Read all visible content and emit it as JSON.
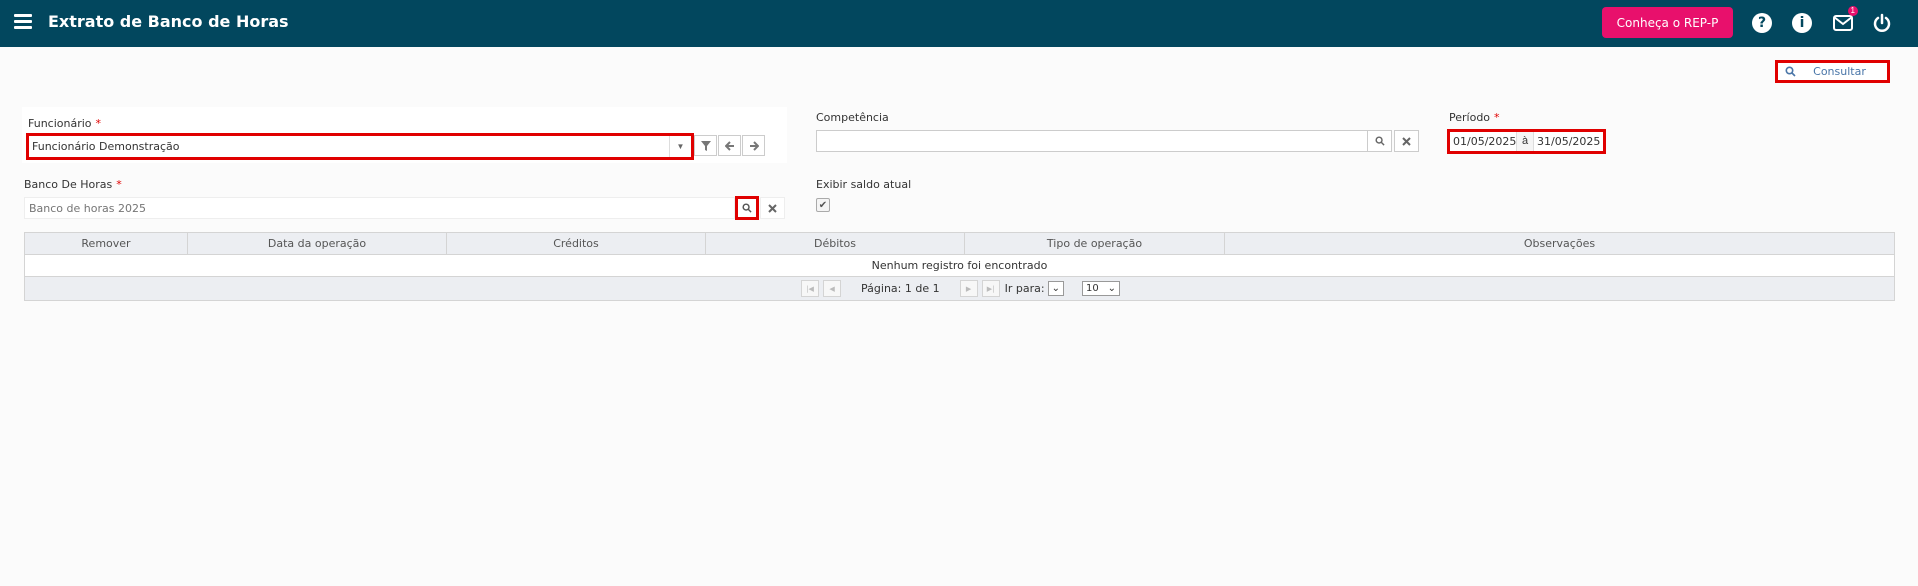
{
  "header": {
    "title": "Extrato de Banco de Horas",
    "rep_button": "Conheça o REP-P",
    "help_icon": "?",
    "info_icon": "i",
    "mail_badge": "1"
  },
  "toolbar": {
    "consultar_label": "Consultar"
  },
  "form": {
    "funcionario_label": "Funcionário",
    "funcionario_value": "Funcionário Demonstração",
    "competencia_label": "Competência",
    "competencia_value": "",
    "periodo_label": "Período",
    "periodo_start": "01/05/2025",
    "periodo_sep": "à",
    "periodo_end": "31/05/2025",
    "banco_label": "Banco De Horas",
    "banco_placeholder": "Banco de horas 2025",
    "exibir_label": "Exibir saldo atual",
    "required_mark": "*"
  },
  "grid": {
    "columns": [
      "Remover",
      "Data da operação",
      "Créditos",
      "Débitos",
      "Tipo de operação",
      "Observações"
    ],
    "empty_message": "Nenhum registro foi encontrado",
    "pager_text": "Página: 1 de 1",
    "goto_label": "Ir para:",
    "page_size": "10"
  }
}
